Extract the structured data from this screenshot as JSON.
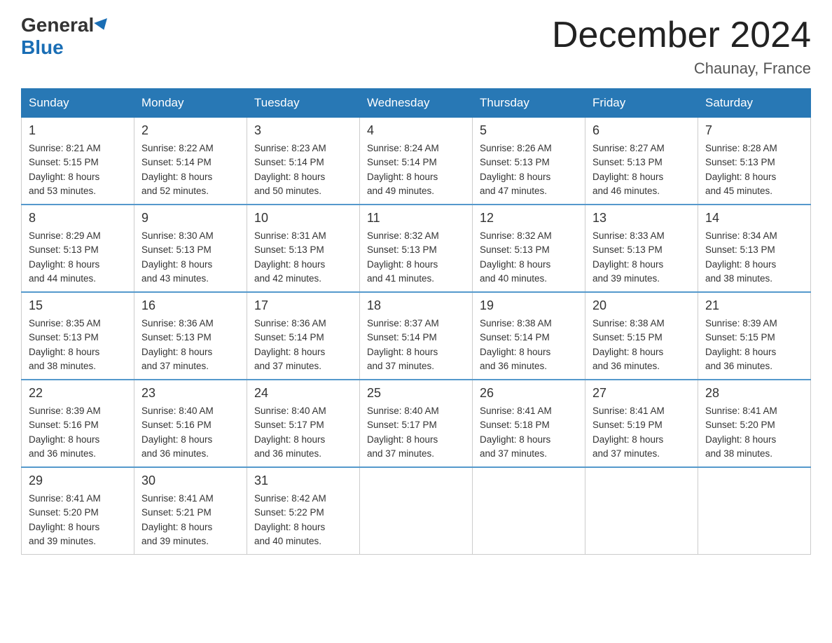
{
  "header": {
    "logo_general": "General",
    "logo_blue": "Blue",
    "month_title": "December 2024",
    "location": "Chaunay, France"
  },
  "weekdays": [
    "Sunday",
    "Monday",
    "Tuesday",
    "Wednesday",
    "Thursday",
    "Friday",
    "Saturday"
  ],
  "weeks": [
    [
      {
        "day": "1",
        "sunrise": "8:21 AM",
        "sunset": "5:15 PM",
        "daylight": "8 hours and 53 minutes."
      },
      {
        "day": "2",
        "sunrise": "8:22 AM",
        "sunset": "5:14 PM",
        "daylight": "8 hours and 52 minutes."
      },
      {
        "day": "3",
        "sunrise": "8:23 AM",
        "sunset": "5:14 PM",
        "daylight": "8 hours and 50 minutes."
      },
      {
        "day": "4",
        "sunrise": "8:24 AM",
        "sunset": "5:14 PM",
        "daylight": "8 hours and 49 minutes."
      },
      {
        "day": "5",
        "sunrise": "8:26 AM",
        "sunset": "5:13 PM",
        "daylight": "8 hours and 47 minutes."
      },
      {
        "day": "6",
        "sunrise": "8:27 AM",
        "sunset": "5:13 PM",
        "daylight": "8 hours and 46 minutes."
      },
      {
        "day": "7",
        "sunrise": "8:28 AM",
        "sunset": "5:13 PM",
        "daylight": "8 hours and 45 minutes."
      }
    ],
    [
      {
        "day": "8",
        "sunrise": "8:29 AM",
        "sunset": "5:13 PM",
        "daylight": "8 hours and 44 minutes."
      },
      {
        "day": "9",
        "sunrise": "8:30 AM",
        "sunset": "5:13 PM",
        "daylight": "8 hours and 43 minutes."
      },
      {
        "day": "10",
        "sunrise": "8:31 AM",
        "sunset": "5:13 PM",
        "daylight": "8 hours and 42 minutes."
      },
      {
        "day": "11",
        "sunrise": "8:32 AM",
        "sunset": "5:13 PM",
        "daylight": "8 hours and 41 minutes."
      },
      {
        "day": "12",
        "sunrise": "8:32 AM",
        "sunset": "5:13 PM",
        "daylight": "8 hours and 40 minutes."
      },
      {
        "day": "13",
        "sunrise": "8:33 AM",
        "sunset": "5:13 PM",
        "daylight": "8 hours and 39 minutes."
      },
      {
        "day": "14",
        "sunrise": "8:34 AM",
        "sunset": "5:13 PM",
        "daylight": "8 hours and 38 minutes."
      }
    ],
    [
      {
        "day": "15",
        "sunrise": "8:35 AM",
        "sunset": "5:13 PM",
        "daylight": "8 hours and 38 minutes."
      },
      {
        "day": "16",
        "sunrise": "8:36 AM",
        "sunset": "5:13 PM",
        "daylight": "8 hours and 37 minutes."
      },
      {
        "day": "17",
        "sunrise": "8:36 AM",
        "sunset": "5:14 PM",
        "daylight": "8 hours and 37 minutes."
      },
      {
        "day": "18",
        "sunrise": "8:37 AM",
        "sunset": "5:14 PM",
        "daylight": "8 hours and 37 minutes."
      },
      {
        "day": "19",
        "sunrise": "8:38 AM",
        "sunset": "5:14 PM",
        "daylight": "8 hours and 36 minutes."
      },
      {
        "day": "20",
        "sunrise": "8:38 AM",
        "sunset": "5:15 PM",
        "daylight": "8 hours and 36 minutes."
      },
      {
        "day": "21",
        "sunrise": "8:39 AM",
        "sunset": "5:15 PM",
        "daylight": "8 hours and 36 minutes."
      }
    ],
    [
      {
        "day": "22",
        "sunrise": "8:39 AM",
        "sunset": "5:16 PM",
        "daylight": "8 hours and 36 minutes."
      },
      {
        "day": "23",
        "sunrise": "8:40 AM",
        "sunset": "5:16 PM",
        "daylight": "8 hours and 36 minutes."
      },
      {
        "day": "24",
        "sunrise": "8:40 AM",
        "sunset": "5:17 PM",
        "daylight": "8 hours and 36 minutes."
      },
      {
        "day": "25",
        "sunrise": "8:40 AM",
        "sunset": "5:17 PM",
        "daylight": "8 hours and 37 minutes."
      },
      {
        "day": "26",
        "sunrise": "8:41 AM",
        "sunset": "5:18 PM",
        "daylight": "8 hours and 37 minutes."
      },
      {
        "day": "27",
        "sunrise": "8:41 AM",
        "sunset": "5:19 PM",
        "daylight": "8 hours and 37 minutes."
      },
      {
        "day": "28",
        "sunrise": "8:41 AM",
        "sunset": "5:20 PM",
        "daylight": "8 hours and 38 minutes."
      }
    ],
    [
      {
        "day": "29",
        "sunrise": "8:41 AM",
        "sunset": "5:20 PM",
        "daylight": "8 hours and 39 minutes."
      },
      {
        "day": "30",
        "sunrise": "8:41 AM",
        "sunset": "5:21 PM",
        "daylight": "8 hours and 39 minutes."
      },
      {
        "day": "31",
        "sunrise": "8:42 AM",
        "sunset": "5:22 PM",
        "daylight": "8 hours and 40 minutes."
      },
      null,
      null,
      null,
      null
    ]
  ],
  "labels": {
    "sunrise": "Sunrise:",
    "sunset": "Sunset:",
    "daylight": "Daylight:"
  }
}
